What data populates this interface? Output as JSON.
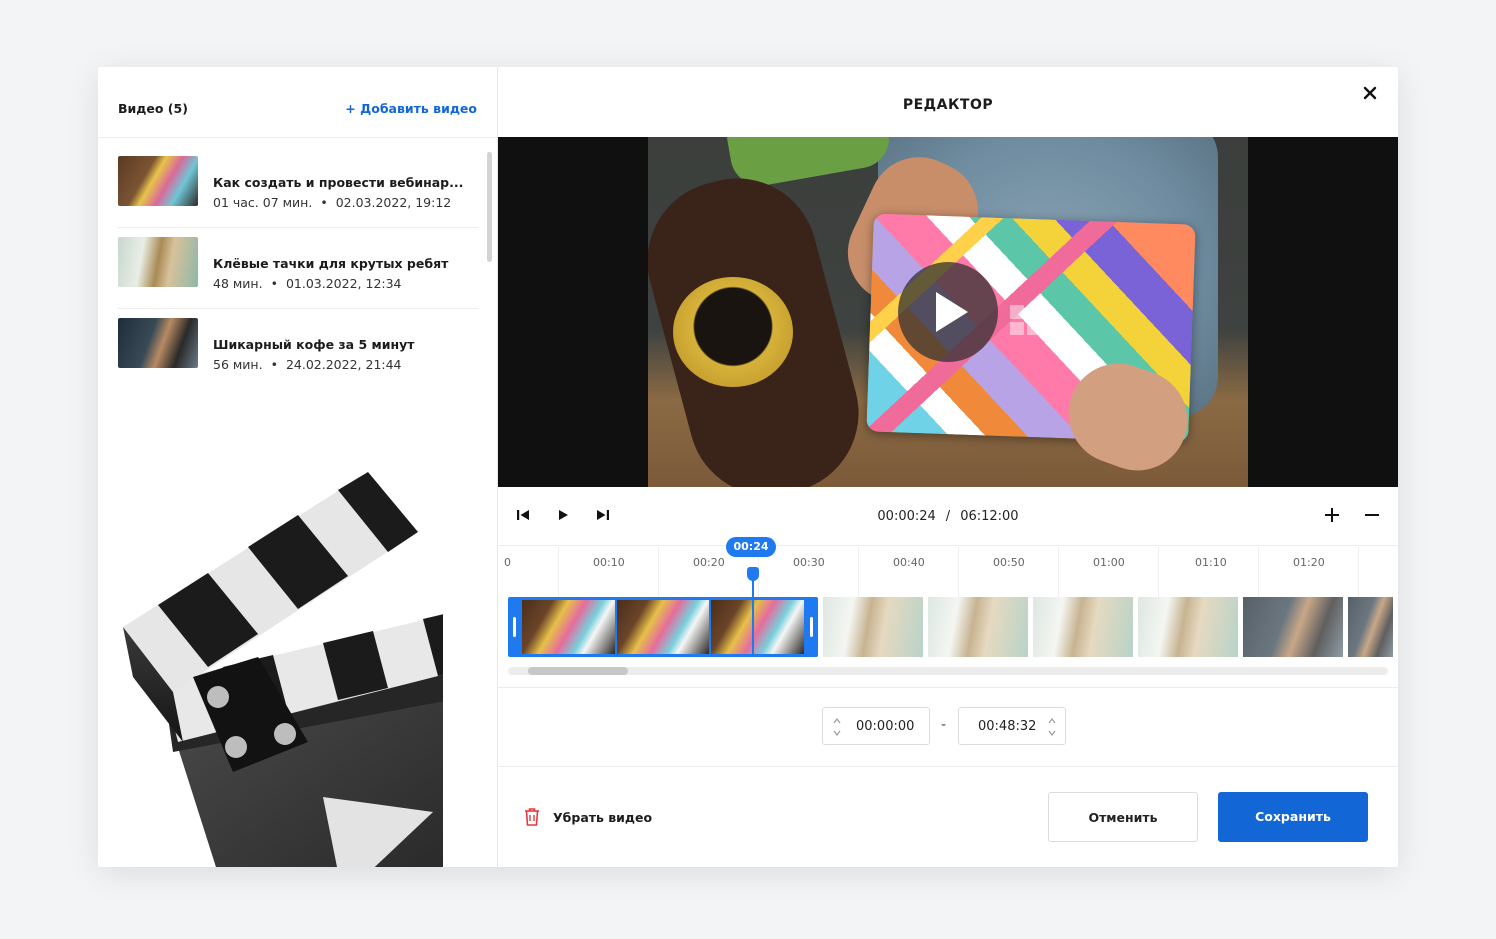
{
  "sidebar": {
    "title": "Видео (5)",
    "add_label": "+ Добавить видео",
    "items": [
      {
        "title": "Как создать и провести вебинар...",
        "duration": "01 час. 07 мин.",
        "date": "02.03.2022, 19:12"
      },
      {
        "title": "Клёвые тачки для крутых ребят",
        "duration": "48 мин.",
        "date": "01.03.2022, 12:34"
      },
      {
        "title": "Шикарный кофе за 5 минут",
        "duration": "56 мин.",
        "date": "24.02.2022, 21:44"
      }
    ],
    "separator": "•"
  },
  "editor": {
    "title": "РЕДАКТОР",
    "close_icon": "close-icon"
  },
  "player": {
    "current_time": "00:00:24",
    "separator": "/",
    "total_time": "06:12:00",
    "playhead_label": "00:24"
  },
  "timeline": {
    "ticks": [
      "0",
      "00:10",
      "00:20",
      "00:30",
      "00:40",
      "00:50",
      "01:00",
      "01:10",
      "01:20"
    ]
  },
  "range": {
    "start": "00:00:00",
    "dash": "-",
    "end": "00:48:32"
  },
  "footer": {
    "remove_label": "Убрать видео",
    "cancel_label": "Отменить",
    "save_label": "Сохранить"
  },
  "colors": {
    "accent": "#1366d6",
    "timeline_accent": "#1f7af0",
    "danger": "#e23b3b"
  }
}
